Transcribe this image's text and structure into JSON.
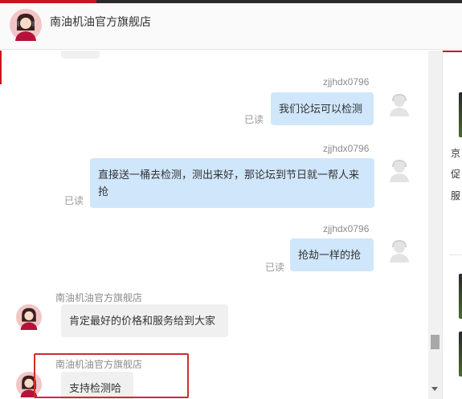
{
  "header": {
    "shop_name": "南油机油官方旗舰店",
    "avatar_icon": "shop-avatar-icon"
  },
  "messages": [
    {
      "side": "right",
      "sender": "zjjhdx0796",
      "text": "我们论坛可以检测",
      "read": "已读"
    },
    {
      "side": "right",
      "sender": "zjjhdx0796",
      "text": "直接送一桶去检测，测出来好，那论坛到节日就一帮人来抢",
      "read": "已读"
    },
    {
      "side": "right",
      "sender": "zjjhdx0796",
      "text": "抢劫一样的抢",
      "read": "已读"
    },
    {
      "side": "left",
      "sender": "南油机油官方旗舰店",
      "text": "肯定最好的价格和服务给到大家"
    },
    {
      "side": "left",
      "sender": "南油机油官方旗舰店",
      "text": "支持检测哈"
    }
  ],
  "sidebar": {
    "text_1": "京",
    "text_2": "促",
    "text_3": "服"
  },
  "colors": {
    "accent_red": "#c8161d",
    "user_bubble": "#cfe6fb",
    "shop_bubble": "#f0f0f0",
    "highlight": "#d22b2b"
  }
}
